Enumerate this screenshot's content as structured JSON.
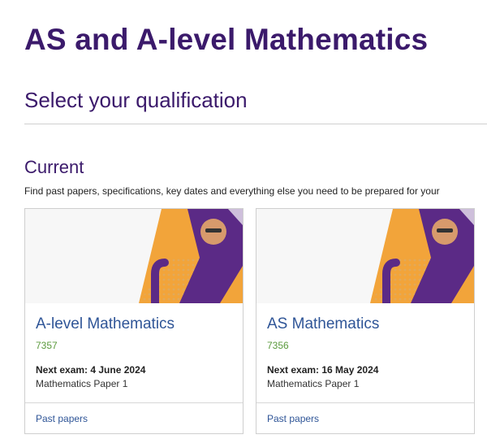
{
  "page": {
    "title": "AS and A-level Mathematics",
    "subtitle": "Select your qualification"
  },
  "section": {
    "heading": "Current",
    "description": "Find past papers, specifications, key dates and everything else you need to be prepared for your"
  },
  "cards": [
    {
      "title": "A-level Mathematics",
      "code": "7357",
      "next_exam": "Next exam: 4 June 2024",
      "paper": "Mathematics Paper 1",
      "link": "Past papers"
    },
    {
      "title": "AS Mathematics",
      "code": "7356",
      "next_exam": "Next exam: 16 May 2024",
      "paper": "Mathematics Paper 1",
      "link": "Past papers"
    }
  ],
  "colors": {
    "heading": "#3b1a6b",
    "link": "#2f5597",
    "code": "#5a9a3c",
    "accent_orange": "#f0a02a",
    "accent_purple": "#5b2a86"
  }
}
